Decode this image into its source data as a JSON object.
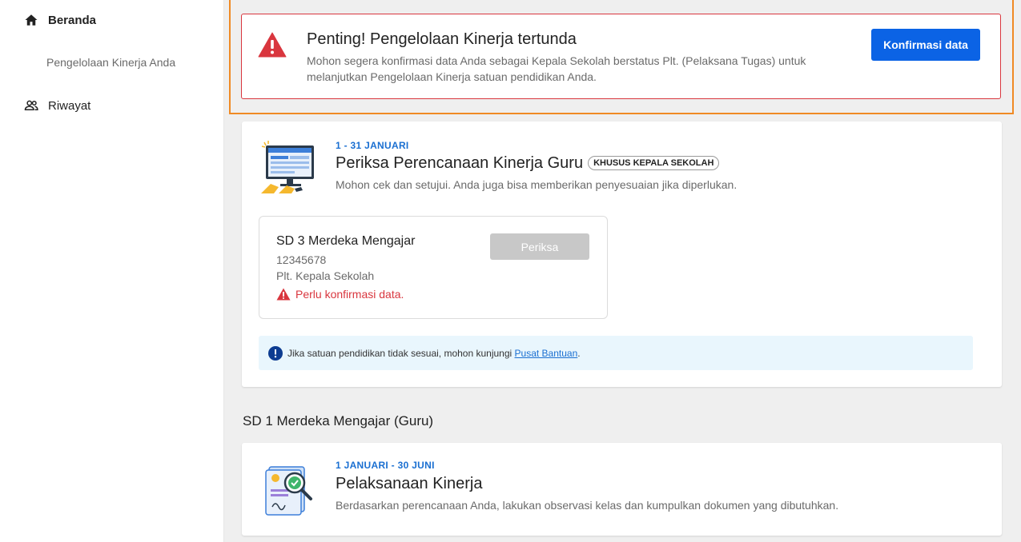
{
  "sidebar": {
    "items": [
      {
        "label": "Beranda",
        "icon": "home-icon"
      },
      {
        "label": "Pengelolaan Kinerja Anda"
      },
      {
        "label": "Riwayat",
        "icon": "people-icon"
      }
    ]
  },
  "alert": {
    "title": "Penting! Pengelolaan Kinerja tertunda",
    "description": "Mohon segera konfirmasi data Anda sebagai Kepala Sekolah berstatus Plt. (Pelaksana Tugas) untuk melanjutkan Pengelolaan Kinerja satuan pendidikan Anda.",
    "button_label": "Konfirmasi data"
  },
  "review_card": {
    "date_range": "1 - 31 JANUARI",
    "title": "Periksa Perencanaan Kinerja Guru",
    "badge": "KHUSUS KEPALA SEKOLAH",
    "subtitle": "Mohon cek dan setujui. Anda juga bisa memberikan penyesuaian jika diperlukan.",
    "school": {
      "name": "SD 3 Merdeka Mengajar",
      "npsn": "12345678",
      "role": "Plt. Kepala Sekolah",
      "warning": "Perlu konfirmasi data.",
      "button_label": "Periksa"
    },
    "info": {
      "text": "Jika satuan pendidikan tidak sesuai, mohon kunjungi ",
      "link": "Pusat Bantuan",
      "suffix": "."
    }
  },
  "section": {
    "title": "SD 1 Merdeka Mengajar (Guru)"
  },
  "execution_card": {
    "date_range": "1 JANUARI - 30 JUNI",
    "title": "Pelaksanaan Kinerja",
    "subtitle": "Berdasarkan perencanaan Anda, lakukan observasi kelas dan kumpulkan dokumen yang dibutuhkan."
  },
  "colors": {
    "primary": "#0b63e5",
    "danger": "#d9363e",
    "highlight": "#f08a24",
    "info_bg": "#e9f6fd"
  }
}
